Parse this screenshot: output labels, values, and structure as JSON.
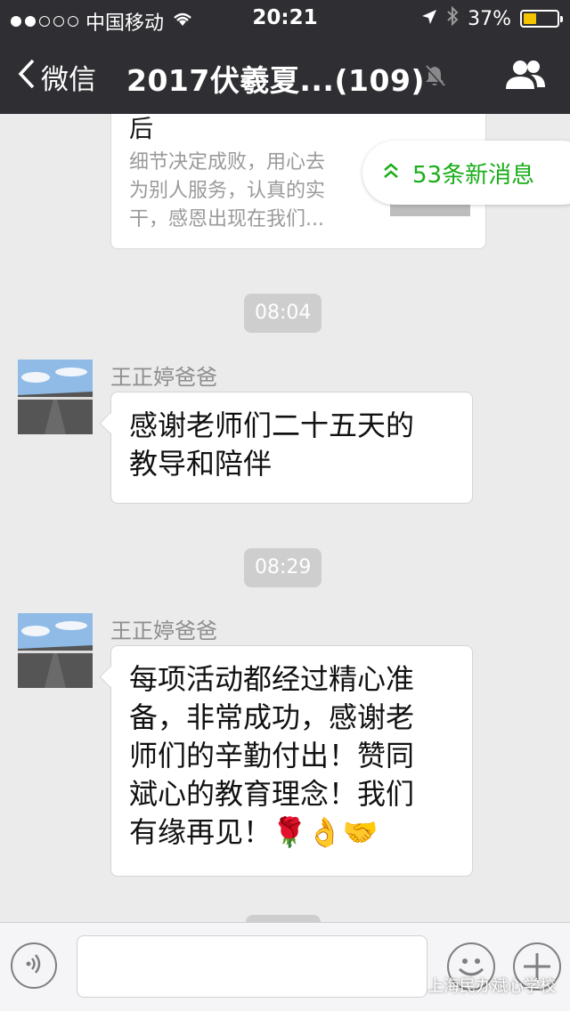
{
  "status_bar": {
    "carrier": "中国移动",
    "time": "20:21",
    "battery_percent": "37%",
    "battery_level": 0.37
  },
  "nav": {
    "back_label": "微信",
    "title": "2017伏羲夏...(109)"
  },
  "link_card": {
    "title": "后",
    "description": "细节决定成败，用心去\n为别人服务，认真的实\n干，感恩出现在我们..."
  },
  "new_messages": {
    "label": "53条新消息"
  },
  "messages": [
    {
      "time": "08:04",
      "sender": "王正婷爸爸",
      "text": "感谢老师们二十五天的\n教导和陪伴"
    },
    {
      "time": "08:29",
      "sender": "王正婷爸爸",
      "text": "每项活动都经过精心准\n备，非常成功，感谢老\n师们的辛勤付出！赞同\n斌心的教育理念！我们\n有缘再见！🌹👌🤝"
    }
  ],
  "watermark": {
    "text": "上海民办斌心学校"
  },
  "colors": {
    "nav_background": "#2f2f33",
    "chat_background": "#ebebeb",
    "accent_green": "#1aad19",
    "battery_yellow": "#f5c400"
  },
  "icons": [
    "wifi-icon",
    "location-icon",
    "bluetooth-icon",
    "battery-icon",
    "back-chevron-icon",
    "mute-bell-icon",
    "group-members-icon",
    "double-chevron-up-icon",
    "voice-icon",
    "emoji-icon",
    "plus-icon",
    "wechat-logo-icon"
  ]
}
